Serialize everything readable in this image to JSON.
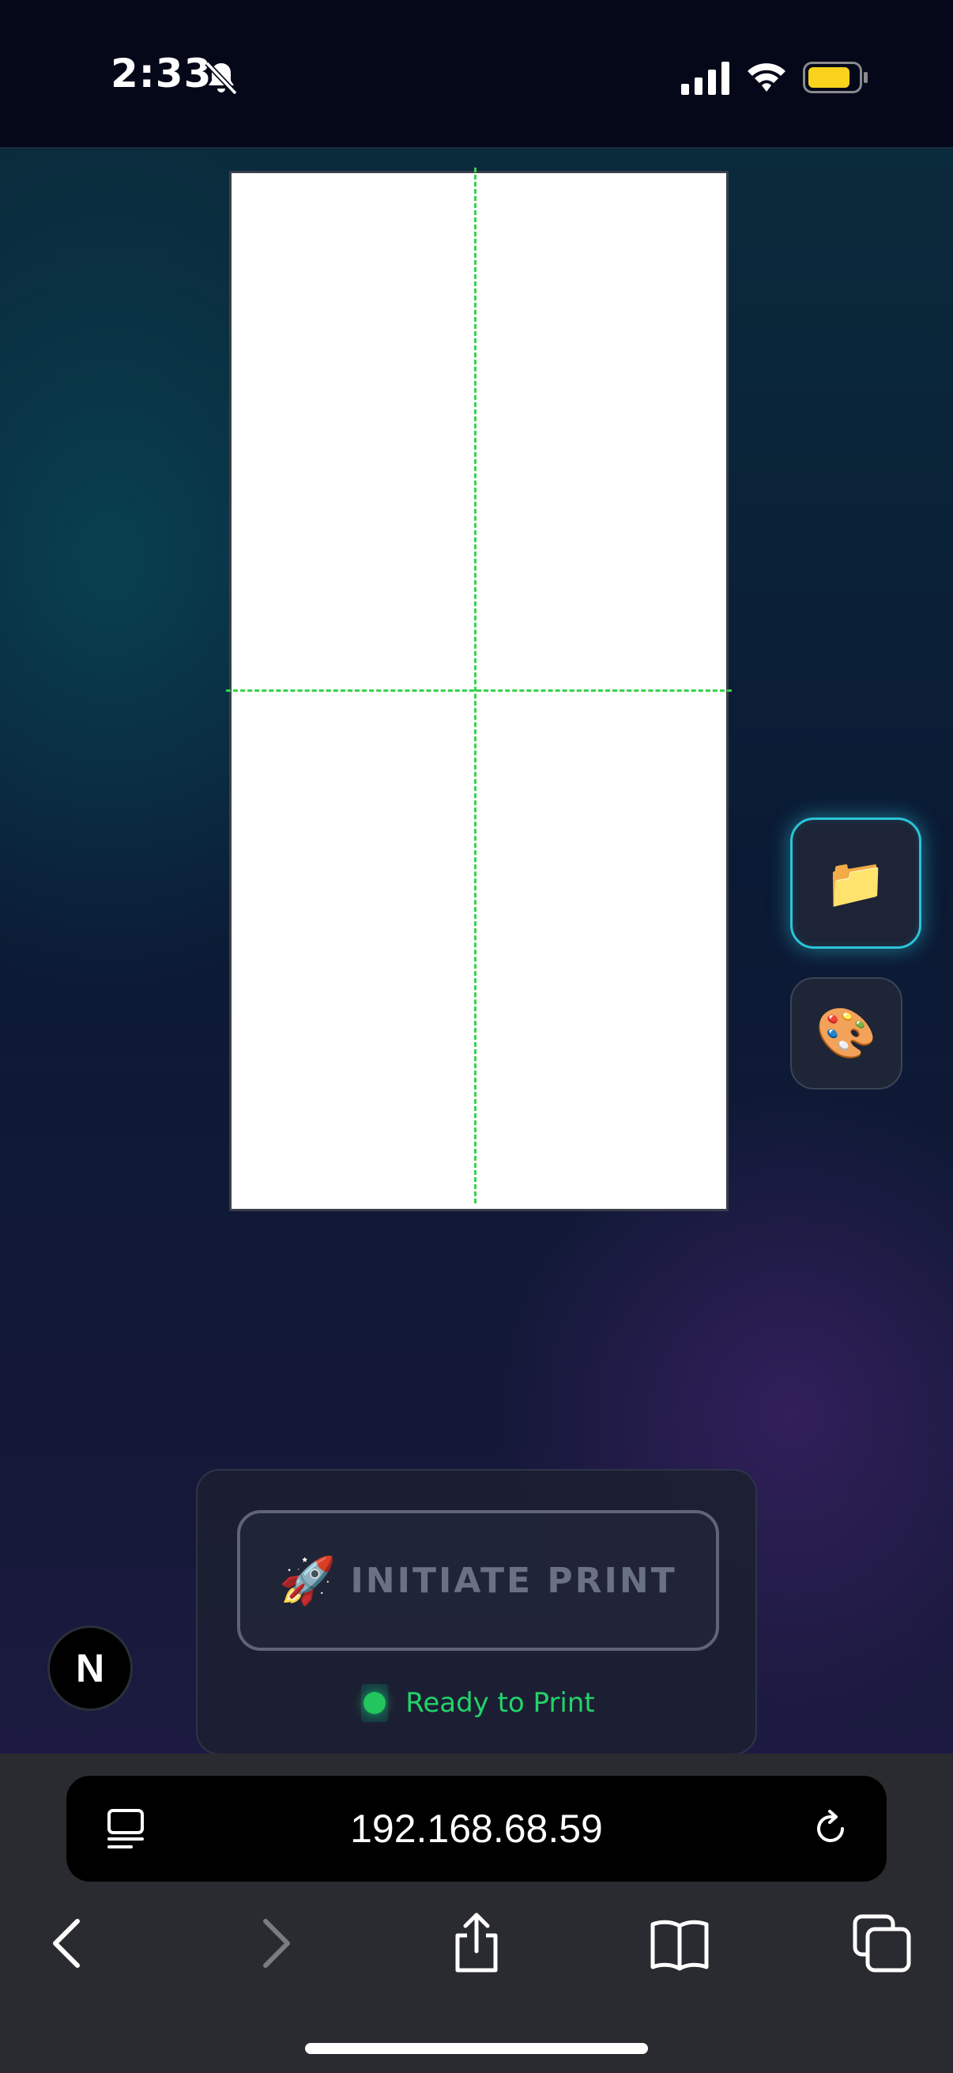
{
  "status_bar": {
    "time": "2:33",
    "icons": [
      "bell-slash-icon",
      "cellular-signal-icon",
      "wifi-icon",
      "battery-icon"
    ],
    "battery_color": "#f8d21c"
  },
  "canvas": {
    "guide_color": "#36d34a"
  },
  "side_buttons": [
    {
      "name": "folder-button",
      "icon": "📁"
    },
    {
      "name": "palette-button",
      "icon": "🎨"
    }
  ],
  "print_panel": {
    "button_icon": "🚀",
    "button_label": "INITIATE PRINT",
    "status_text": "Ready to Print",
    "status_color": "#22c55e"
  },
  "badge": {
    "letter": "N"
  },
  "browser": {
    "url": "192.168.68.59",
    "icons": [
      "reader-icon",
      "reload-icon",
      "back-icon",
      "forward-icon",
      "share-icon",
      "bookmarks-icon",
      "tabs-icon"
    ]
  }
}
